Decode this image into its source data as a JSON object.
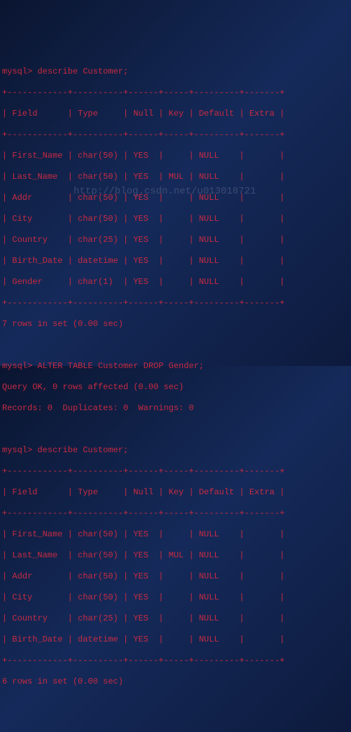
{
  "prompt": "mysql>",
  "commands": {
    "describe1": "describe Customer;",
    "alter": "ALTER TABLE Customer DROP Gender;",
    "describe2": "describe Customer;"
  },
  "table_border_top": "+------------+----------+------+-----+---------+-------+",
  "table_header": "| Field      | Type     | Null | Key | Default | Extra |",
  "table1_rows": [
    "| First_Name | char(50) | YES  |     | NULL    |       |",
    "| Last_Name  | char(50) | YES  | MUL | NULL    |       |",
    "| Addr       | char(50) | YES  |     | NULL    |       |",
    "| City       | char(50) | YES  |     | NULL    |       |",
    "| Country    | char(25) | YES  |     | NULL    |       |",
    "| Birth_Date | datetime | YES  |     | NULL    |       |",
    "| Gender     | char(1)  | YES  |     | NULL    |       |"
  ],
  "result1": "7 rows in set (0.00 sec)",
  "alter_result1": "Query OK, 0 rows affected (0.00 sec)",
  "alter_result2": "Records: 0  Duplicates: 0  Warnings: 0",
  "table2_rows": [
    "| First_Name | char(50) | YES  |     | NULL    |       |",
    "| Last_Name  | char(50) | YES  | MUL | NULL    |       |",
    "| Addr       | char(50) | YES  |     | NULL    |       |",
    "| City       | char(50) | YES  |     | NULL    |       |",
    "| Country    | char(25) | YES  |     | NULL    |       |",
    "| Birth_Date | datetime | YES  |     | NULL    |       |"
  ],
  "result2": "6 rows in set (0.00 sec)",
  "watermark": "http://blog.csdn.net/u013018721"
}
